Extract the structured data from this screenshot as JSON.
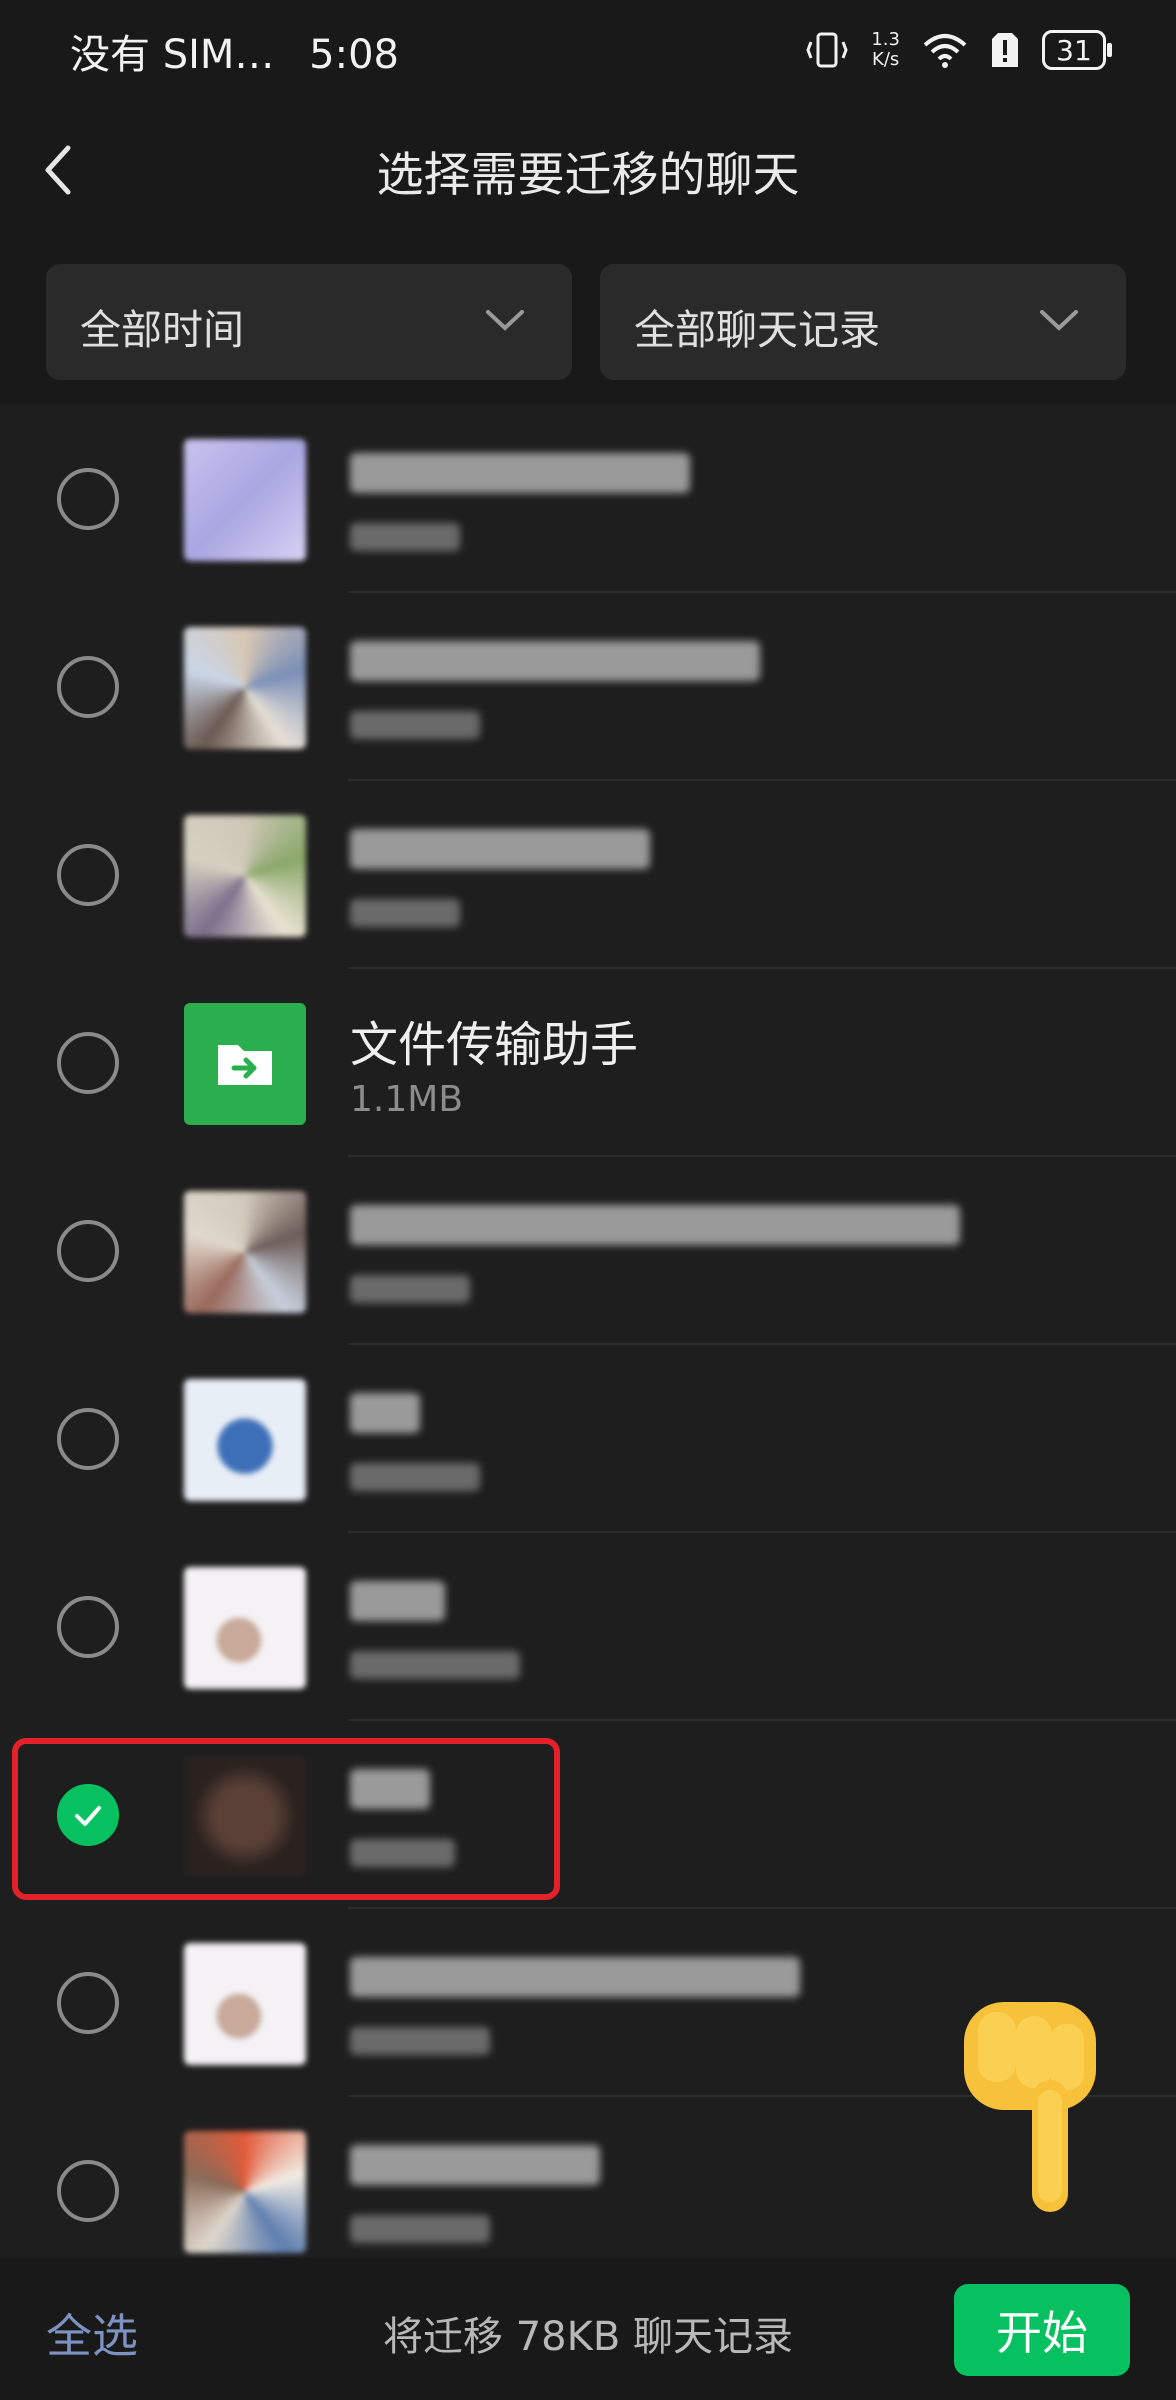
{
  "status_bar": {
    "carrier": "没有 SIM…",
    "time": "5:08",
    "net_speed_value": "1.3",
    "net_speed_unit": "K/s",
    "battery": "31"
  },
  "header": {
    "title": "选择需要迁移的聊天"
  },
  "filters": {
    "time_filter": "全部时间",
    "type_filter": "全部聊天记录"
  },
  "chats": [
    {
      "name": "",
      "size": "",
      "blurred": true,
      "checked": false
    },
    {
      "name": "",
      "size": "",
      "blurred": true,
      "checked": false
    },
    {
      "name": "",
      "size": "",
      "blurred": true,
      "checked": false
    },
    {
      "name": "文件传输助手",
      "size": "1.1MB",
      "blurred": false,
      "checked": false
    },
    {
      "name": "",
      "size": "",
      "blurred": true,
      "checked": false
    },
    {
      "name": "",
      "size": "",
      "blurred": true,
      "checked": false
    },
    {
      "name": "",
      "size": "",
      "blurred": true,
      "checked": false
    },
    {
      "name": "",
      "size": "",
      "blurred": true,
      "checked": true
    },
    {
      "name": "",
      "size": "",
      "blurred": true,
      "checked": false
    },
    {
      "name": "",
      "size": "",
      "blurred": true,
      "checked": false
    }
  ],
  "footer": {
    "select_all": "全选",
    "summary": "将迁移 78KB 聊天记录",
    "start": "开始"
  },
  "colors": {
    "accent": "#07c160",
    "highlight": "#e3212a",
    "select_all": "#7e92c2"
  }
}
